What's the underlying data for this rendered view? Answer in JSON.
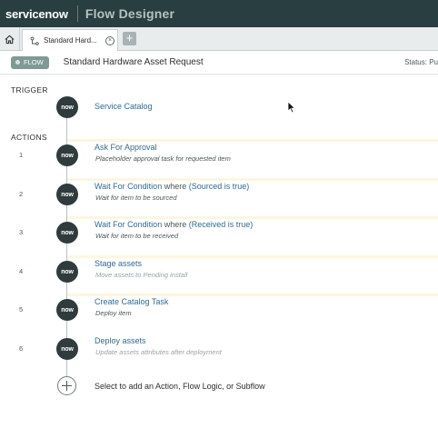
{
  "topbar": {
    "brand": "servicenow",
    "app_title": "Flow Designer"
  },
  "tabs": [
    {
      "label": "Standard Hard..."
    }
  ],
  "flow": {
    "badge": "FLOW",
    "name": "Standard Hardware Asset Request",
    "status": "Status: Pu"
  },
  "trigger": {
    "section_label": "TRIGGER",
    "title": "Service Catalog"
  },
  "actions_label": "ACTIONS",
  "actions": [
    {
      "num": "1",
      "title": "Ask For Approval",
      "desc": "Placeholder approval task for requested item"
    },
    {
      "num": "2",
      "title": "Wait For Condition",
      "where": "where",
      "cond": "(Sourced is true)",
      "desc": "Wait for item to be sourced"
    },
    {
      "num": "3",
      "title": "Wait For Condition",
      "where": "where",
      "cond": "(Received is true)",
      "desc": "Wait for item to be received"
    },
    {
      "num": "4",
      "title": "Stage assets",
      "desc": "Move assets to Pending install"
    },
    {
      "num": "5",
      "title": "Create Catalog Task",
      "desc": "Deploy item"
    },
    {
      "num": "6",
      "title": "Deploy assets",
      "desc": "Update assets attributes after deployment"
    }
  ],
  "step_icon_text": "now",
  "add_step_label": "Select to add an Action, Flow Logic, or Subflow"
}
